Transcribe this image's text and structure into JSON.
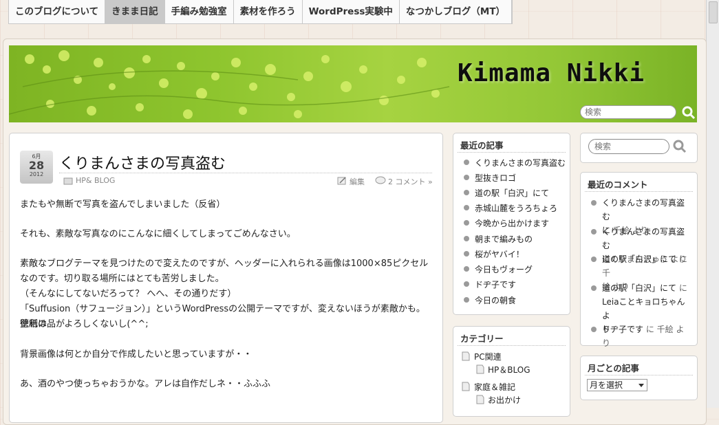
{
  "nav": {
    "items": [
      {
        "label": "このブログについて",
        "active": false
      },
      {
        "label": "きまま日記",
        "active": true
      },
      {
        "label": "手編み勉強室",
        "active": false
      },
      {
        "label": "素材を作ろう",
        "active": false
      },
      {
        "label": "WordPress実験中",
        "active": false
      },
      {
        "label": "なつかしブログ（MT）",
        "active": false
      }
    ]
  },
  "header": {
    "site_title": "Kimama Nikki",
    "search_placeholder": "検索"
  },
  "post": {
    "date": {
      "month": "6月",
      "day": "28",
      "year": "2012"
    },
    "title": "くりまんさまの写真盗む",
    "category": "HP& BLOG",
    "edit_label": "編集",
    "comments_label": "2 コメント »",
    "paragraphs": [
      "またもや無断で写真を盗んでしまいました（反省）",
      "それも、素敵な写真なのにこんなに細くしてしまってごめんなさい。",
      "素敵なブログテーマを見つけたので変えたのですが、ヘッダーに入れられる画像は1000×85ピクセル",
      "なのです。切り取る場所にはとても苦労しました。",
      "（そんなにしてないだろって？ へへ、その通りだす）",
      "「Suffusion（サフュージョン）」というWordPressの公開テーマですが、変えないほうが素敵かも。徳利の",
      "壁紙は品がよろしくないし(^^;",
      "背景画像は何とか自分で作成したいと思っていますが・・",
      "あ、酒のやつ使っちゃおうかな。アレは自作だしネ・・ふふふ"
    ]
  },
  "recent_posts": {
    "title": "最近の記事",
    "items": [
      "くりまんさまの写真盗む",
      "型抜きロゴ",
      "道の駅「白沢」にて",
      "赤城山麓をうろちょろ",
      "今晩から出かけます",
      "朝まで編みもの",
      "桜がヤバイ！",
      "今日もヴォーグ",
      "ドヂ子です",
      "今日の朝食"
    ]
  },
  "categories": {
    "title": "カテゴリー",
    "items": [
      {
        "label": "PC関連",
        "level": 0
      },
      {
        "label": "HP＆BLOG",
        "level": 1
      },
      {
        "label": "家庭＆雑記",
        "level": 0
      },
      {
        "label": "お出かけ",
        "level": 1
      }
    ]
  },
  "sidebar_search": {
    "placeholder": "検索"
  },
  "recent_comments": {
    "title": "最近のコメント",
    "items": [
      {
        "l1": "くりまんさまの写真盗む",
        "l2a": "に",
        "l2b": " 千絵 より",
        "l3": ""
      },
      {
        "l1": "くりまんさまの写真盗む",
        "l2a": "に",
        "l2b": "くりまんじゅう より",
        "l3": ""
      },
      {
        "l1": "道の駅「白沢」にて",
        "l2a": " に 千",
        "l2b": "絵 より",
        "l3": ""
      },
      {
        "l1": "道の駅「白沢」にて",
        "l2a": " に",
        "l2b": "Leiaことキョロちゃん よ",
        "l3": "り"
      },
      {
        "l1": "ドヂ子です",
        "l2a": " に 千絵 より",
        "l2b": "",
        "l3": ""
      }
    ]
  },
  "archives": {
    "title": "月ごとの記事",
    "select_value": "月を選択"
  },
  "colors": {
    "accent_green": "#8ec52e",
    "active_tab": "#c9c9c9"
  }
}
